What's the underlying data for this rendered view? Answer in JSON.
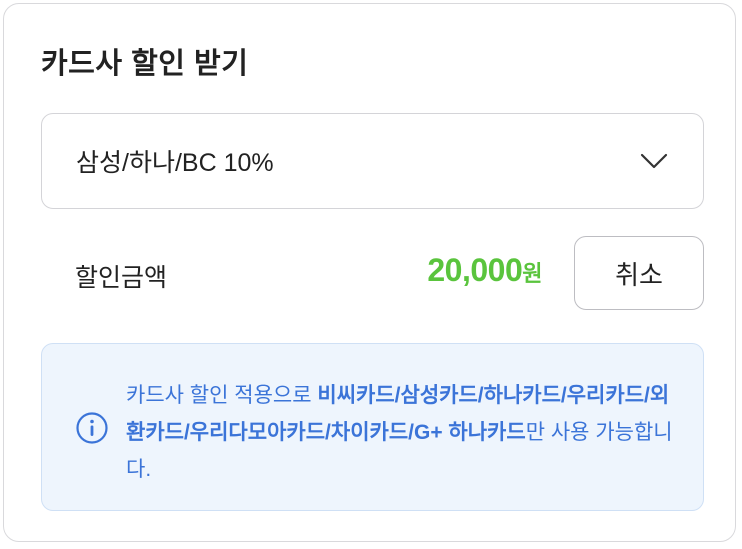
{
  "title": "카드사 할인 받기",
  "select": {
    "value": "삼성/하나/BC 10%",
    "icon": "chevron-down-icon"
  },
  "discount": {
    "label": "할인금액",
    "amount": "20,000",
    "unit": "원",
    "cancel_label": "취소"
  },
  "notice": {
    "icon": "info-icon",
    "prefix": "카드사 할인 적용으로 ",
    "cards": "비씨카드/삼성카드/하나카드/우리카드/외환카드/우리다모아카드/차이카드/G+ 하나카드",
    "suffix": "만 사용 가능합니다."
  },
  "colors": {
    "amount": "#5ac43d",
    "notice_text": "#3b74d8",
    "notice_bg": "#eef5fd",
    "border": "#d4d4d8"
  }
}
